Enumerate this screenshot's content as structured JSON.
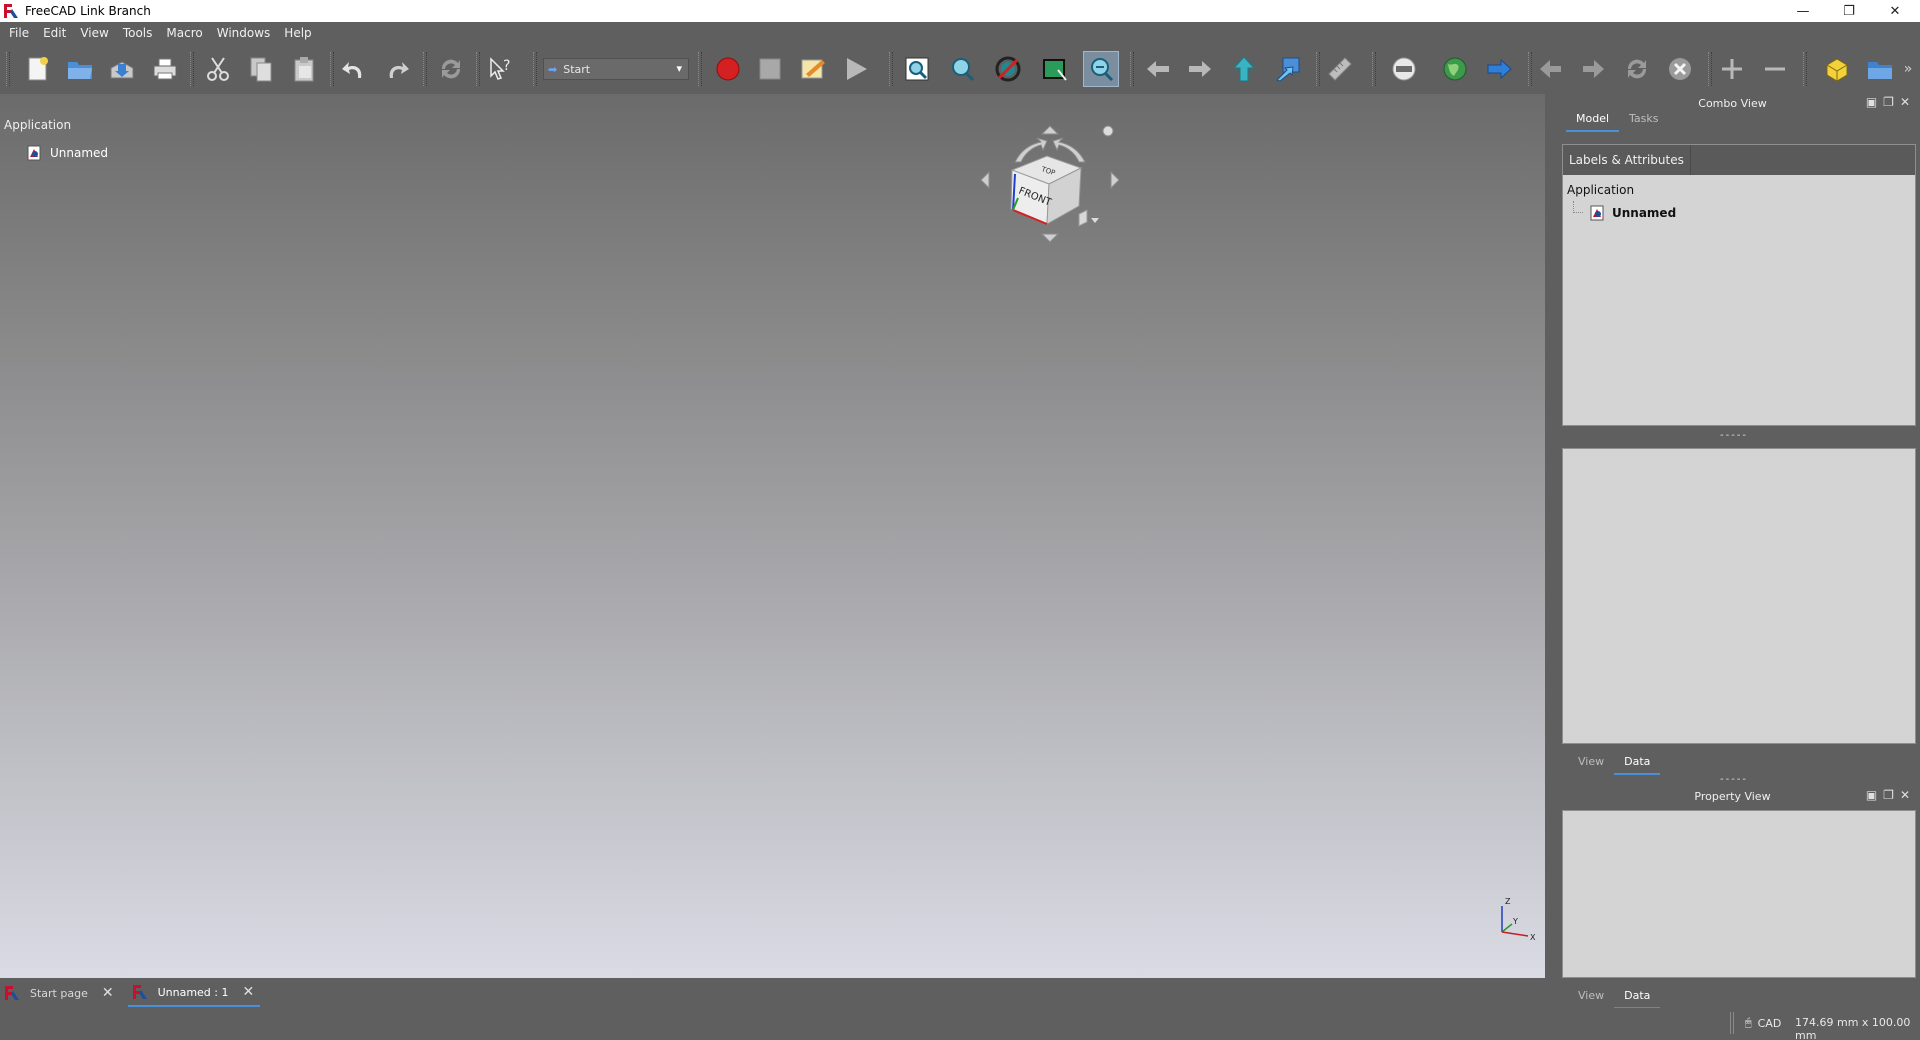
{
  "window": {
    "title": "FreeCAD Link Branch"
  },
  "menu": [
    "File",
    "Edit",
    "View",
    "Tools",
    "Macro",
    "Windows",
    "Help"
  ],
  "workbench": {
    "selected": "Start"
  },
  "tree": {
    "root": "Application",
    "document": "Unnamed"
  },
  "navcube": {
    "face_front": "FRONT",
    "face_top": "TOP"
  },
  "axis": {
    "x": "X",
    "y": "Y",
    "z": "Z"
  },
  "combo_view": {
    "title": "Combo View",
    "tabs": [
      "Model",
      "Tasks"
    ],
    "active_tab": "Model",
    "header_label": "Labels & Attributes",
    "tree_root": "Application",
    "tree_document": "Unnamed",
    "lower_tabs": [
      "View",
      "Data"
    ],
    "active_lower_tab": "Data"
  },
  "property_view": {
    "title": "Property View",
    "tabs": [
      "View",
      "Data"
    ],
    "active_tab": "Data"
  },
  "doc_tabs": [
    {
      "label": "Start page",
      "active": false
    },
    {
      "label": "Unnamed : 1",
      "active": true
    }
  ],
  "status": {
    "nav_style": "CAD",
    "dimensions": "174.69 mm x 100.00 mm"
  },
  "colors": {
    "accent": "#4a90d9",
    "background": "#5f5f5f",
    "record": "#d42020"
  }
}
